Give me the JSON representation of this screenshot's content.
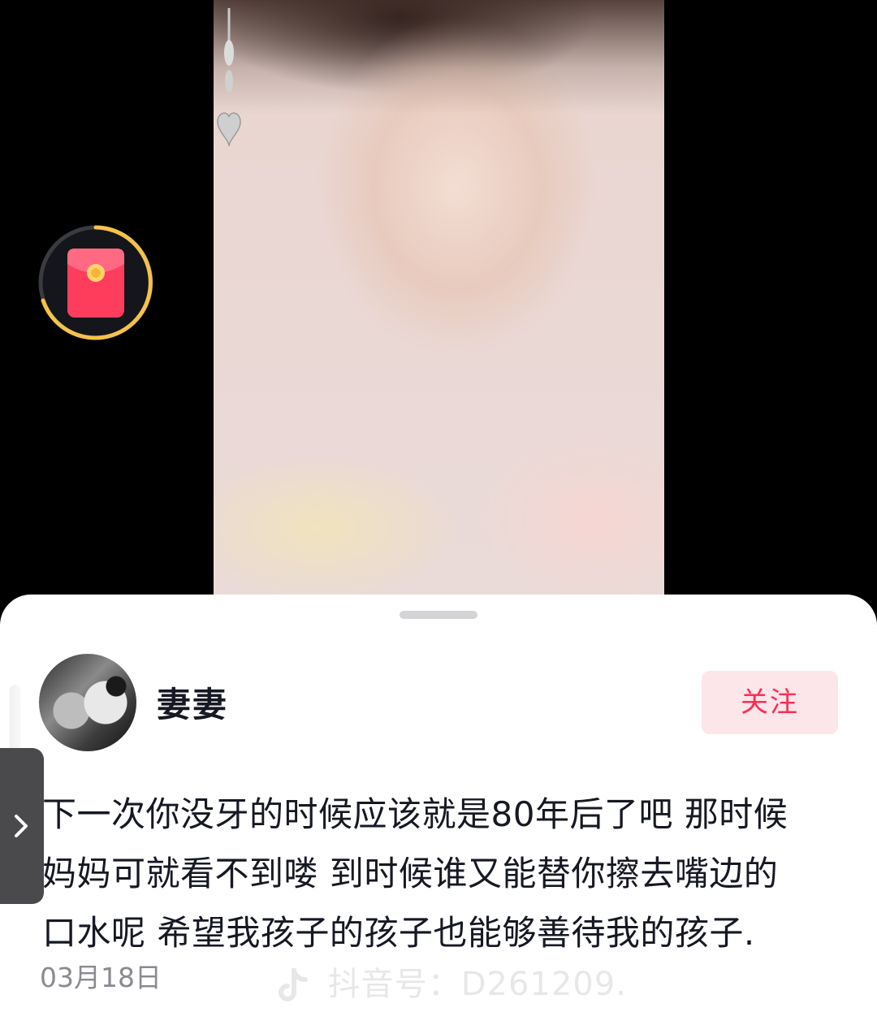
{
  "video": {
    "description_icon": "red-envelope-icon"
  },
  "sheet": {
    "username": "妻妻",
    "follow_label": "关注",
    "comment_lines": [
      "下一次你没牙的时候应该就是80年后了吧 那时候",
      "妈妈可就看不到喽 到时候谁又能替你擦去嘴边的",
      "口水呢 希望我孩子的孩子也能够善待我的孩子."
    ],
    "date": "03月18日",
    "watermark": "抖音号：D261209."
  },
  "colors": {
    "accent": "#fe2c55",
    "follow_bg": "#fde6ea",
    "progress_ring": "#f5c24a"
  }
}
